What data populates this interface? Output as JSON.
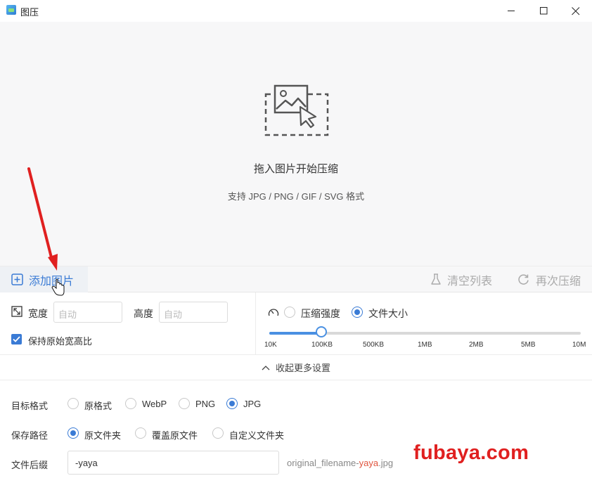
{
  "window": {
    "title": "图压",
    "icon": "app-icon",
    "controls": [
      "minimize-icon",
      "maximize-icon",
      "close-icon"
    ]
  },
  "dropzone": {
    "icon": "image-drop-icon",
    "title": "拖入图片开始压缩",
    "subtitle": "支持 JPG / PNG / GIF / SVG 格式"
  },
  "actions": {
    "add_label": "添加图片",
    "clear_label": "清空列表",
    "recompress_label": "再次压缩"
  },
  "size": {
    "width_label": "宽度",
    "width_placeholder": "自动",
    "height_label": "高度",
    "height_placeholder": "自动",
    "keep_ratio_label": "保持原始宽高比",
    "keep_ratio_checked": true
  },
  "compress": {
    "mode_strength_label": "压缩强度",
    "mode_filesize_label": "文件大小",
    "selected_mode": "文件大小",
    "slider_value": "100KB",
    "ticks": [
      "10K",
      "100KB",
      "500KB",
      "1MB",
      "2MB",
      "5MB",
      "10M"
    ]
  },
  "collapse_label": "收起更多设置",
  "format": {
    "label": "目标格式",
    "options": [
      "原格式",
      "WebP",
      "PNG",
      "JPG"
    ],
    "selected": "JPG"
  },
  "save_path": {
    "label": "保存路径",
    "options": [
      "原文件夹",
      "覆盖原文件",
      "自定义文件夹"
    ],
    "selected": "原文件夹"
  },
  "suffix": {
    "label": "文件后缀",
    "value": "-yaya",
    "preview_prefix": "original_filename-",
    "preview_highlight": "yaya",
    "preview_suffix": ".jpg"
  },
  "watermark": "fubaya.com",
  "colors": {
    "accent": "#3a7bd5",
    "annotation": "#e02020"
  }
}
